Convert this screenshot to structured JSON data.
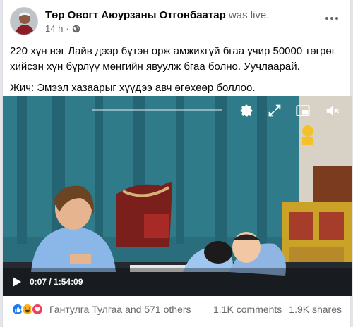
{
  "post": {
    "author": "Төр Овогт Аюурзаны Отгонбаатар",
    "author_suffix": "was live.",
    "time": "14 h",
    "separator": "·",
    "paragraph1": "220 хүн нэг Лайв дээр бүтэн орж амжихгүй бгаа учир 50000 төгрөг хийсэн хүн бүрлүү мөнгийн явуулж бгаа болно. Уучлаарай.",
    "paragraph2": "Жич: Эмээл хазаарыг хүүдээ авч өгөхөөр боллоо."
  },
  "video": {
    "current_time": "0:07",
    "duration": "1:54:09",
    "time_separator": " / ",
    "progress_fraction": 0.001
  },
  "icons": {
    "privacy": "globe-icon",
    "more": "more-options-icon",
    "play": "play-icon",
    "settings": "gear-icon",
    "fullscreen": "expand-icon",
    "pip": "picture-in-picture-icon",
    "volume": "speaker-muted-icon"
  },
  "engagement": {
    "reaction_names": "Гантулга Тулгаа and 571 others",
    "comments": "1.1K comments",
    "shares": "1.9K shares"
  },
  "colors": {
    "brand_blue": "#1877f2",
    "haha_yellow": "#f7b125",
    "love_red": "#f33e58",
    "muted_text": "#65676b"
  }
}
